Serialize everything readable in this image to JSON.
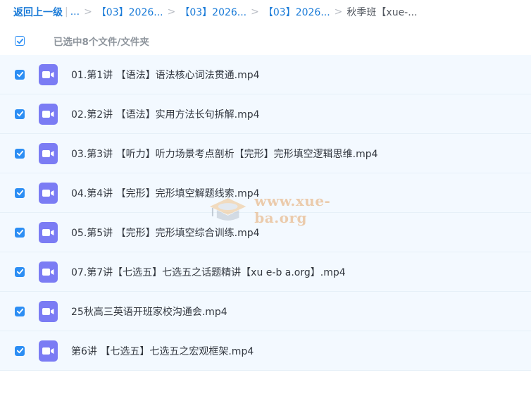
{
  "breadcrumb": {
    "back_label": "返回上一级",
    "ellipsis": "...",
    "crumbs": [
      "【03】2026...",
      "【03】2026...",
      "【03】2026..."
    ],
    "current": "秋季班【xue-..."
  },
  "selection": {
    "summary": "已选中8个文件/文件夹",
    "all_checked": true
  },
  "files": [
    {
      "name": "01.第1讲 【语法】语法核心词法贯通.mp4",
      "checked": true
    },
    {
      "name": "02.第2讲 【语法】实用方法长句拆解.mp4",
      "checked": true
    },
    {
      "name": "03.第3讲 【听力】听力场景考点剖析【完形】完形填空逻辑思维.mp4",
      "checked": true
    },
    {
      "name": "04.第4讲 【完形】完形填空解题线索.mp4",
      "checked": true
    },
    {
      "name": "05.第5讲 【完形】完形填空综合训练.mp4",
      "checked": true
    },
    {
      "name": "07.第7讲【七选五】七选五之话题精讲【xu e-b a.org】.mp4",
      "checked": true
    },
    {
      "name": "25秋高三英语开班家校沟通会.mp4",
      "checked": true
    },
    {
      "name": "第6讲 【七选五】七选五之宏观框架.mp4",
      "checked": true
    }
  ],
  "watermark": {
    "text": "www.xue-ba.org"
  },
  "colors": {
    "accent": "#2c8ef4",
    "link": "#1a7bd8",
    "video_icon": "#7b7cf4",
    "row_bg": "#f3f9ff"
  },
  "icons": {
    "file": "video-file-icon",
    "check": "check-icon"
  }
}
